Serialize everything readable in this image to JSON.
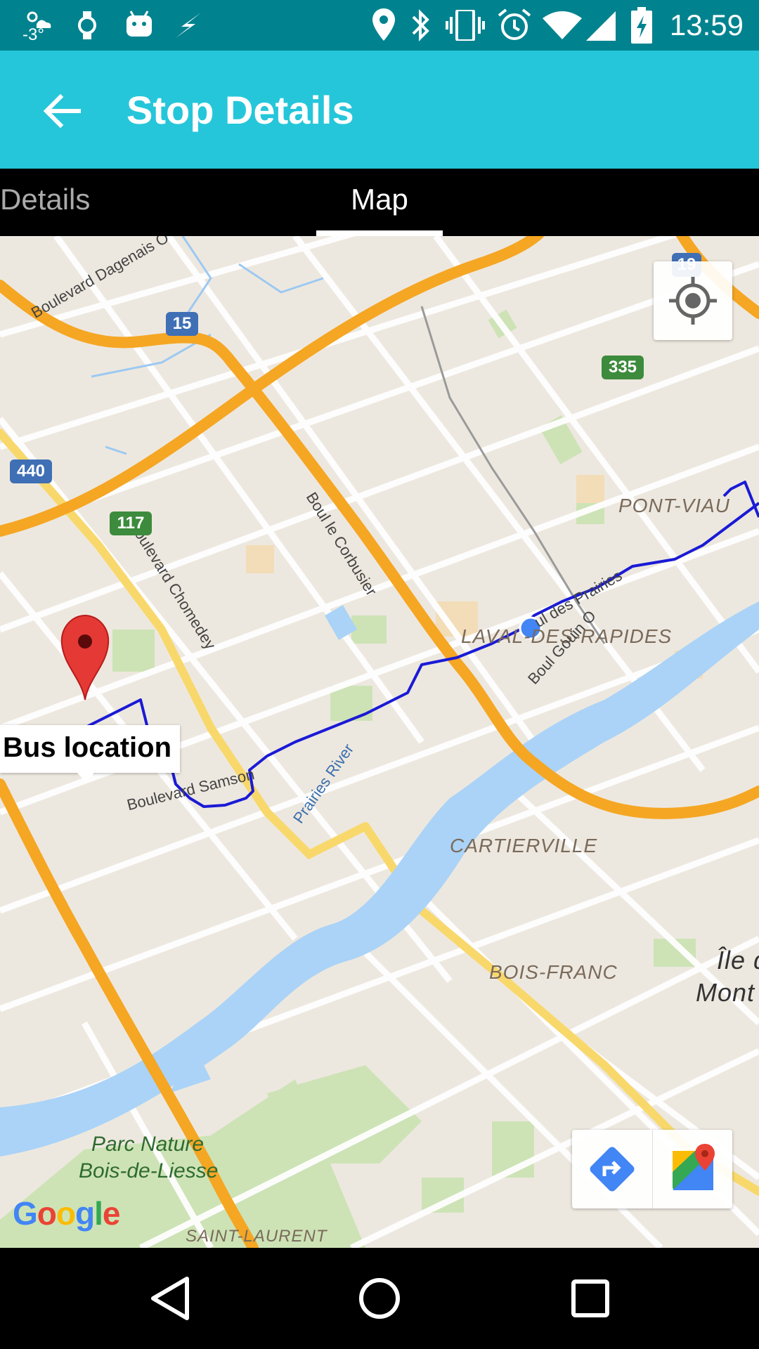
{
  "status_bar": {
    "time": "13:59",
    "temperature": "-3°",
    "icons": [
      "weather-icon",
      "watch-icon",
      "android-icon",
      "flash-icon",
      "location-icon",
      "bluetooth-icon",
      "vibrate-icon",
      "alarm-icon",
      "wifi-icon",
      "signal-icon",
      "battery-charging-icon"
    ]
  },
  "app_bar": {
    "title": "Stop Details",
    "back_icon": "arrow-back-icon"
  },
  "tabs": [
    {
      "label": "Details",
      "selected": false
    },
    {
      "label": "Map",
      "selected": true
    }
  ],
  "map": {
    "area_labels": [
      "PONT-VIAU",
      "LAVAL-DES-RAPIDES",
      "CARTIERVILLE",
      "BOIS-FRANC",
      "SAINT-LAURENT",
      "Île d",
      "Mont"
    ],
    "road_labels": [
      "Boulevard Dagenais O",
      "Boul le Corbusier",
      "Boulevard Chomedey",
      "ul des Prairies",
      "Boul Gouin O",
      "Boulevard Samson",
      "Prairies River"
    ],
    "park_label": [
      "Parc Nature",
      "Bois-de-Liesse"
    ],
    "highway_shields": [
      {
        "label": "15",
        "color": "blue"
      },
      {
        "label": "19",
        "color": "blue"
      },
      {
        "label": "440",
        "color": "blue"
      },
      {
        "label": "335",
        "color": "green"
      },
      {
        "label": "117",
        "color": "green"
      }
    ],
    "marker": {
      "title": "Bus location",
      "icon": "map-pin-icon"
    },
    "attribution": "Google",
    "colors": {
      "route": "#1a1ad6",
      "highway": "#F5A623",
      "water": "#AAD3F7",
      "park": "#CDE3B6",
      "current_location": "#4285F4"
    }
  },
  "map_controls": {
    "my_location_icon": "my-location-icon",
    "directions_icon": "directions-icon",
    "open_maps_icon": "google-maps-icon"
  },
  "nav_bar": {
    "icons": [
      "back-triangle-icon",
      "home-circle-icon",
      "recents-square-icon"
    ]
  }
}
